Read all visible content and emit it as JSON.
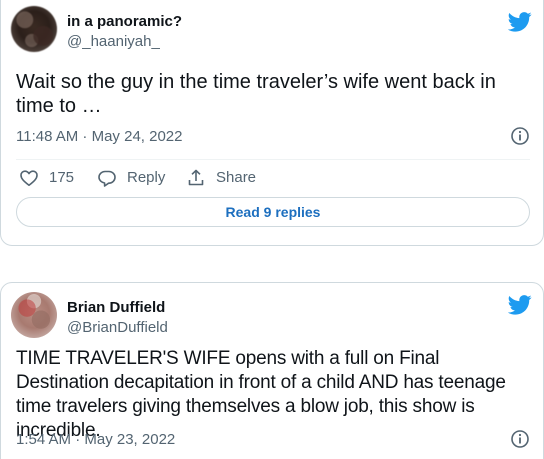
{
  "tweets": [
    {
      "display_name": "in a panoramic?",
      "handle": "@_haaniyah_",
      "text": "Wait so the guy in the time traveler’s wife went back in time to …",
      "timestamp": "11:48 AM · May 24, 2022",
      "likes": "175",
      "reply_label": "Reply",
      "share_label": "Share",
      "read_replies_label": "Read 9 replies"
    },
    {
      "display_name": "Brian Duffield",
      "handle": "@BrianDuffield",
      "text": "TIME TRAVELER'S WIFE opens with a full on Final Destination decapitation in front of a child AND has teenage time travelers giving themselves a blow job, this show is incredible.",
      "timestamp": "1:54 AM · May 23, 2022"
    }
  ],
  "colors": {
    "twitter_blue": "#1d9bf0",
    "text_secondary": "#536471",
    "link_blue": "#1d6fbf"
  }
}
